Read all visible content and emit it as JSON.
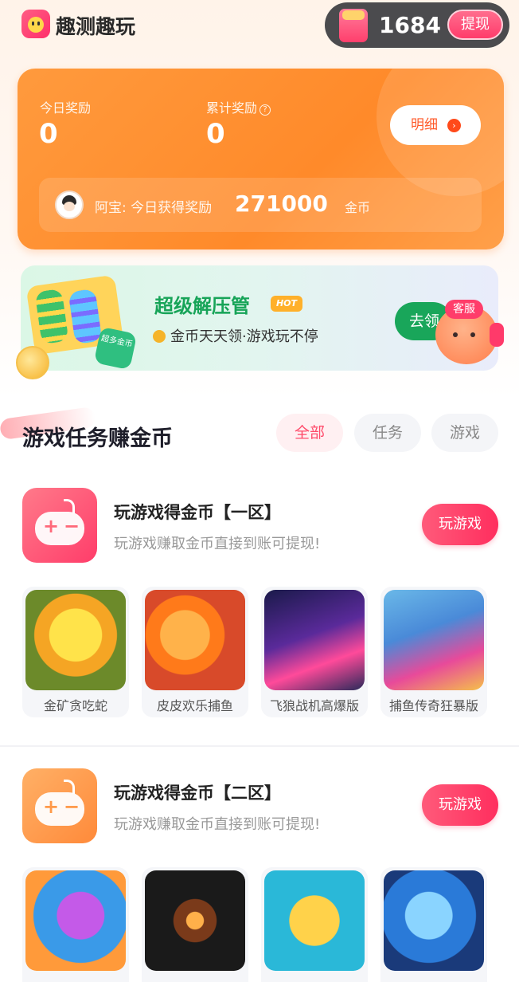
{
  "header": {
    "app_title": "趣测趣玩",
    "coin_balance": "1684",
    "withdraw_label": "提现"
  },
  "reward_card": {
    "today_label": "今日奖励",
    "today_value": "0",
    "total_label": "累计奖励",
    "total_value": "0",
    "help_glyph": "?",
    "detail_label": "明细",
    "detail_arrow": "›",
    "ticker": {
      "text": "阿宝: 今日获得奖励",
      "amount": "271000",
      "unit": "金币"
    }
  },
  "banner": {
    "title": "超级解压管",
    "hot_badge": "HOT",
    "subtitle": "金币天天领·游戏玩不停",
    "badge_text": "超多金币",
    "go_label": "去领",
    "support_label": "客服"
  },
  "section": {
    "title": "游戏任务赚金币",
    "filters": [
      "全部",
      "任务",
      "游戏"
    ]
  },
  "zones": [
    {
      "title": "玩游戏得金币【一区】",
      "subtitle": "玩游戏赚取金币直接到账可提现!",
      "play_label": "玩游戏",
      "games": [
        "金矿贪吃蛇",
        "皮皮欢乐捕鱼",
        "飞狼战机高爆版",
        "捕鱼传奇狂暴版"
      ]
    },
    {
      "title": "玩游戏得金币【二区】",
      "subtitle": "玩游戏赚取金币直接到账可提现!",
      "play_label": "玩游戏",
      "games": [
        "",
        "",
        "",
        ""
      ]
    }
  ],
  "colors": {
    "accent": "#ff3d6a",
    "orange": "#ff8a2a",
    "green": "#17a458"
  }
}
